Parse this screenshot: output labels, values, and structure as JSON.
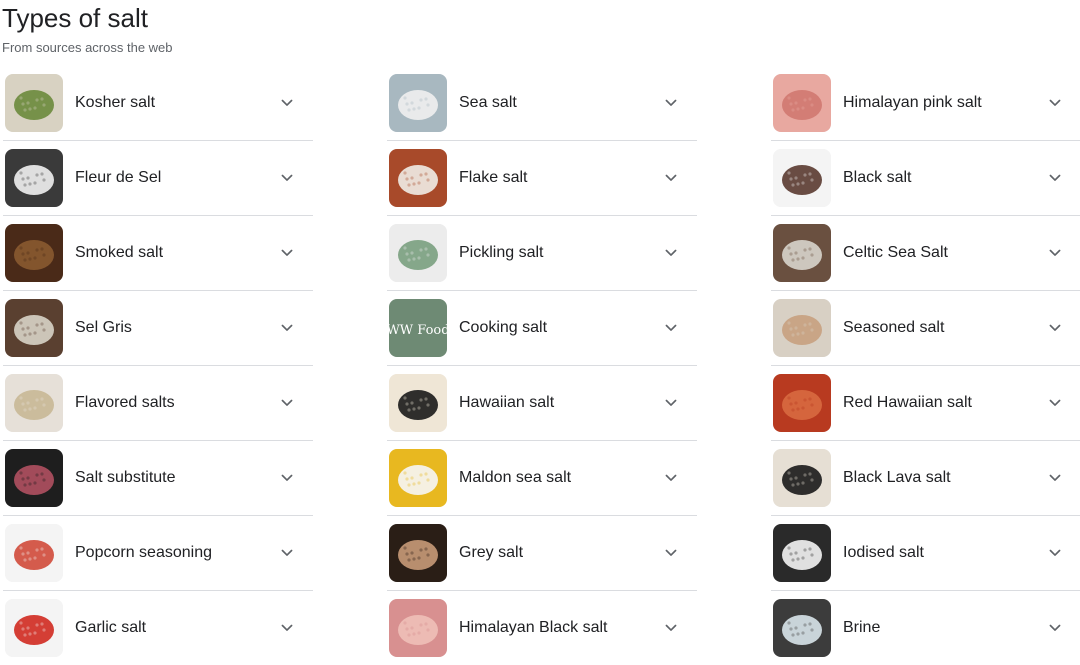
{
  "header": {
    "title": "Types of salt",
    "subtitle": "From sources across the web"
  },
  "columns": [
    {
      "items": [
        {
          "label": "Kosher salt",
          "thumb": "kosher-salt-bowl",
          "bg": "#d8d2c2",
          "fg": "#6b8a3c"
        },
        {
          "label": "Fleur de Sel",
          "thumb": "fleur-de-sel-crystals",
          "bg": "#3a3a3a",
          "fg": "#f2f2f2"
        },
        {
          "label": "Smoked salt",
          "thumb": "smoked-salt-pile",
          "bg": "#4a2a18",
          "fg": "#8a5a30"
        },
        {
          "label": "Sel Gris",
          "thumb": "sel-gris-bowl",
          "bg": "#5a4030",
          "fg": "#d8d4c8"
        },
        {
          "label": "Flavored salts",
          "thumb": "flavored-salt-spoon",
          "bg": "#e6e0d8",
          "fg": "#c8b896"
        },
        {
          "label": "Salt substitute",
          "thumb": "meat-on-board",
          "bg": "#1e1e1e",
          "fg": "#b05060"
        },
        {
          "label": "Popcorn seasoning",
          "thumb": "seasoning-jars",
          "bg": "#f4f4f4",
          "fg": "#d04a3a"
        },
        {
          "label": "Garlic salt",
          "thumb": "garlic-salt-bottle",
          "bg": "#f4f4f4",
          "fg": "#d02a20"
        }
      ]
    },
    {
      "items": [
        {
          "label": "Sea salt",
          "thumb": "sea-salt-pans",
          "bg": "#a8b8c0",
          "fg": "#f0f0f0"
        },
        {
          "label": "Flake salt",
          "thumb": "flake-salt-crystals",
          "bg": "#a84a2a",
          "fg": "#f0ece6"
        },
        {
          "label": "Pickling salt",
          "thumb": "pickling-salt-bag",
          "bg": "#ececec",
          "fg": "#7aa080"
        },
        {
          "label": "Cooking salt",
          "thumb": "ww-food-logo",
          "bg": "#6e8a74",
          "fg": "#ffffff",
          "logo_text": "WW Food"
        },
        {
          "label": "Hawaiian salt",
          "thumb": "hawaiian-salt-bowl",
          "bg": "#efe6d6",
          "fg": "#1a1a1a"
        },
        {
          "label": "Maldon sea salt",
          "thumb": "maldon-salt-bowl",
          "bg": "#e8b820",
          "fg": "#f6f6f6"
        },
        {
          "label": "Grey salt",
          "thumb": "grey-salt-hand",
          "bg": "#2a1e16",
          "fg": "#c89a78"
        },
        {
          "label": "Himalayan Black salt",
          "thumb": "himalayan-black-salt",
          "bg": "#d89090",
          "fg": "#f0c0b8"
        }
      ]
    },
    {
      "items": [
        {
          "label": "Himalayan pink salt",
          "thumb": "pink-salt-bowl",
          "bg": "#e8a8a0",
          "fg": "#d07870"
        },
        {
          "label": "Black salt",
          "thumb": "black-salt-lumps",
          "bg": "#f4f4f4",
          "fg": "#5a3a30"
        },
        {
          "label": "Celtic Sea Salt",
          "thumb": "celtic-salt-bowl",
          "bg": "#6a5040",
          "fg": "#d8d4cc"
        },
        {
          "label": "Seasoned salt",
          "thumb": "seasoned-salt-bowl",
          "bg": "#d8d0c4",
          "fg": "#c8a080"
        },
        {
          "label": "Red Hawaiian salt",
          "thumb": "red-hawaiian-salt",
          "bg": "#b83a20",
          "fg": "#d86a40"
        },
        {
          "label": "Black Lava salt",
          "thumb": "black-lava-salt",
          "bg": "#e6dfd4",
          "fg": "#1a1a1a"
        },
        {
          "label": "Iodised salt",
          "thumb": "iodised-salt-pile",
          "bg": "#2a2a2a",
          "fg": "#f4f4f4"
        },
        {
          "label": "Brine",
          "thumb": "brine-glass",
          "bg": "#3c3c3c",
          "fg": "#d8e4ea"
        }
      ]
    }
  ],
  "icons": {
    "expand": "chevron-down-icon"
  },
  "colors": {
    "text_primary": "#202124",
    "text_secondary": "#5f6368",
    "divider": "#dadce0",
    "chevron": "#5f6368"
  }
}
